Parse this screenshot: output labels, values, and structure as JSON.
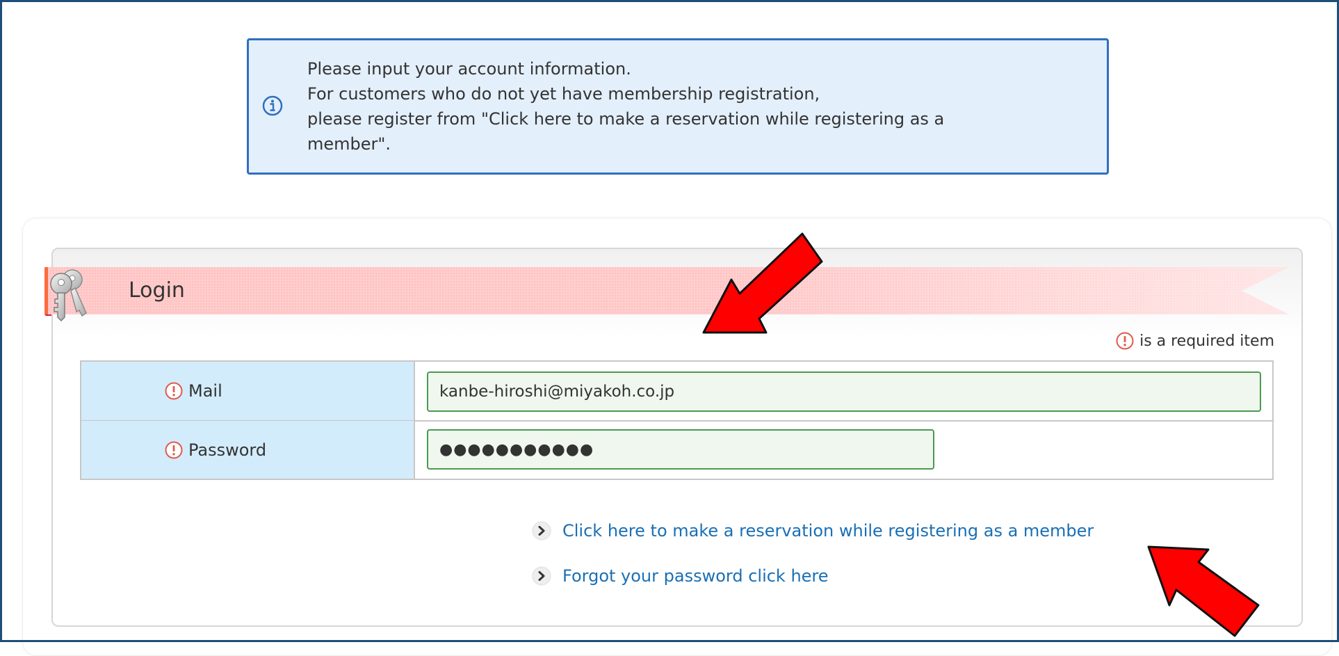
{
  "info": {
    "icon": "info-icon",
    "lines": [
      "Please input your account information.",
      "For customers who do not yet have membership registration,",
      "please register from \"Click here to make a reservation while registering as a",
      "member\"."
    ]
  },
  "login": {
    "title": "Login",
    "icon": "key-icon",
    "required_note": "is a required item",
    "fields": {
      "mail": {
        "label": "Mail",
        "value": "kanbe-hiroshi@miyakoh.co.jp"
      },
      "password": {
        "label": "Password",
        "value": "●●●●●●●●●●●"
      }
    },
    "links": {
      "register": "Click here to make a reservation while registering as a member",
      "forgot": "Forgot your password click here"
    }
  },
  "colors": {
    "info_bg": "#e3effb",
    "info_border": "#2f6fc0",
    "label_bg": "#d3ecfb",
    "field_bg": "#eff7ee",
    "field_border": "#4a9a4e",
    "link": "#1a6fb5",
    "required": "#e05a4e",
    "ribbon": "#ffc9c9",
    "annotation_arrow": "#ff0000"
  },
  "annotations": {
    "arrows": [
      "red-arrow-icon",
      "red-arrow-icon"
    ]
  }
}
